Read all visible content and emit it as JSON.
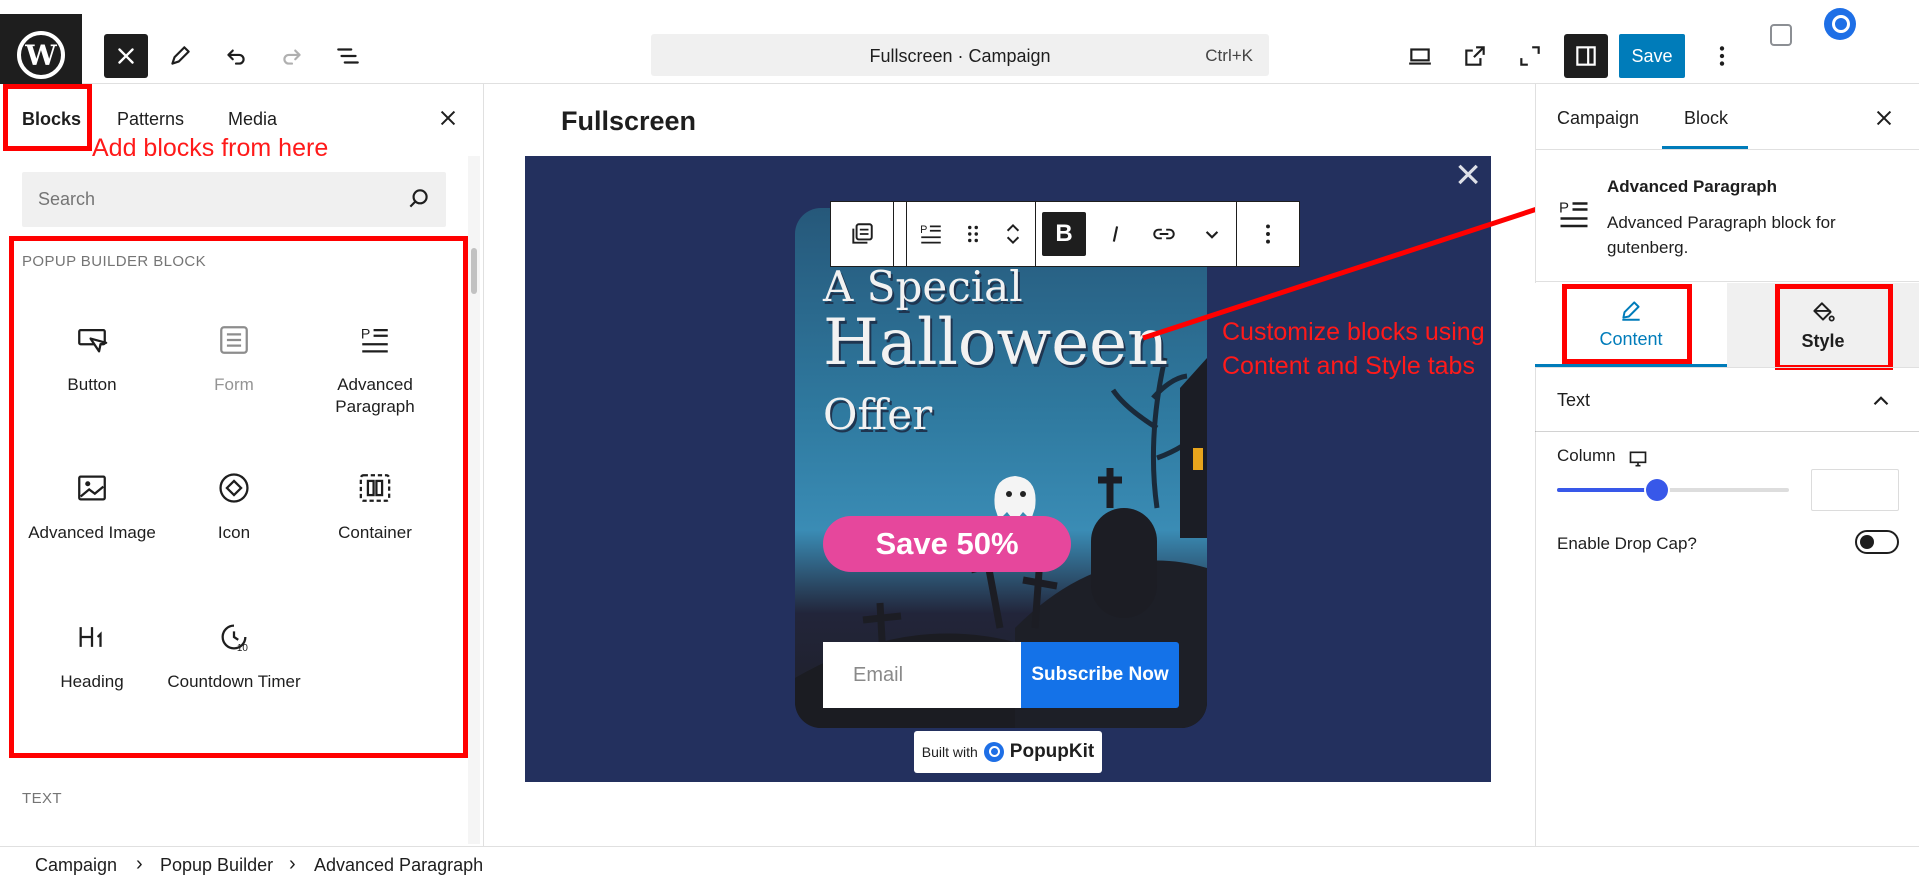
{
  "topbar": {
    "command_title": "Fullscreen · Campaign",
    "shortcut": "Ctrl+K",
    "save_label": "Save"
  },
  "inserter": {
    "tabs": [
      "Blocks",
      "Patterns",
      "Media"
    ],
    "annotation": "Add blocks from here",
    "search_placeholder": "Search",
    "category_popup": "POPUP BUILDER BLOCK",
    "category_text": "TEXT",
    "blocks": [
      {
        "label": "Button",
        "icon": "button-cursor-icon",
        "disabled": false
      },
      {
        "label": "Form",
        "icon": "form-icon",
        "disabled": true
      },
      {
        "label": "Advanced Paragraph",
        "icon": "advanced-paragraph-icon",
        "disabled": false
      },
      {
        "label": "Advanced Image",
        "icon": "image-icon",
        "disabled": false
      },
      {
        "label": "Icon",
        "icon": "diamond-icon",
        "disabled": false
      },
      {
        "label": "Container",
        "icon": "container-icon",
        "disabled": false
      },
      {
        "label": "Heading",
        "icon": "heading-icon",
        "disabled": false
      },
      {
        "label": "Countdown Timer",
        "icon": "countdown-timer-icon",
        "disabled": false
      }
    ]
  },
  "canvas": {
    "title": "Fullscreen",
    "popup": {
      "line1": "A Special",
      "line2": "Halloween",
      "line3": "Offer",
      "save_badge": "Save 50%",
      "email_placeholder": "Email",
      "subscribe_label": "Subscribe Now"
    },
    "built_with": "Built with",
    "brand": "PopupKit",
    "annotation_line1": "Customize blocks using",
    "annotation_line2": "Content and Style tabs"
  },
  "sidebar": {
    "tabs": [
      "Campaign",
      "Block"
    ],
    "active_tab": "Block",
    "block_name": "Advanced Paragraph",
    "block_desc": "Advanced Paragraph block for gutenberg.",
    "content_tab": "Content",
    "style_tab": "Style",
    "panel_title": "Text",
    "column_label": "Column",
    "column_value_fraction": 0.43,
    "drop_cap_label": "Enable Drop Cap?",
    "drop_cap_enabled": false
  },
  "breadcrumb": [
    "Campaign",
    "Popup Builder",
    "Advanced Paragraph"
  ],
  "colors": {
    "accent": "#007cba",
    "annotation": "#ff0000",
    "overlay_bg": "#23305e",
    "save_badge": "#e6479c",
    "subscribe": "#1472e8"
  }
}
